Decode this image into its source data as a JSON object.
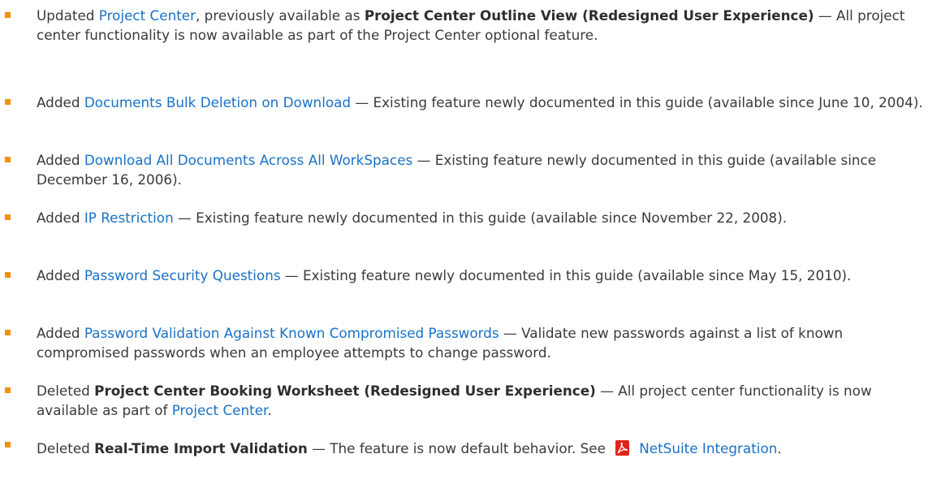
{
  "entries": [
    {
      "verb": "Updated",
      "link": "Project Center",
      "mid": ", previously available as ",
      "bold": "Project Center Outline View (Redesigned User Experience)",
      "dash": " — All project center functionality is now available as part of the Project Center optional feature."
    },
    {
      "verb": "Added",
      "link": "Documents Bulk Deletion on Download",
      "dash": " — Existing feature newly documented in this guide (available since June 10, 2004)."
    },
    {
      "verb": "Added",
      "link": "Download All Documents Across All WorkSpaces",
      "dash": " — Existing feature newly documented in this guide (available since December 16, 2006)."
    },
    {
      "verb": "Added",
      "link": "IP Restriction",
      "dash": " — Existing feature newly documented in this guide (available since November 22, 2008)."
    },
    {
      "verb": "Added",
      "link": "Password Security Questions",
      "dash": " — Existing feature newly documented in this guide (available since May 15, 2010)."
    },
    {
      "verb": "Added",
      "link": "Password Validation Against Known Compromised Passwords",
      "dash": " — Validate new passwords against a list of known compromised passwords when an employee attempts to change password."
    },
    {
      "verb": "Deleted",
      "bold": "Project Center Booking Worksheet (Redesigned User Experience)",
      "dash": " — All project center functionality is now available as part of ",
      "link": "Project Center",
      "end": "."
    },
    {
      "verb": "Deleted",
      "bold": "Real-Time Import Validation",
      "dash": " — The feature is now default behavior. See ",
      "icon": "pdf-icon",
      "link": "NetSuite Integration",
      "end": "."
    }
  ]
}
